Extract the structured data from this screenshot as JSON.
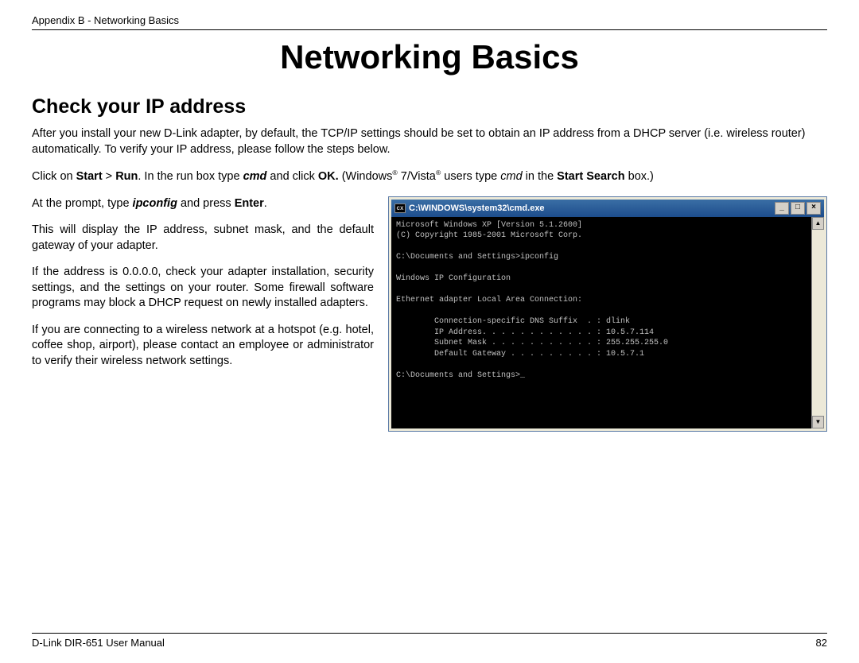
{
  "header": {
    "appendix": "Appendix B - Networking Basics"
  },
  "title": "Networking Basics",
  "section": "Check your IP address",
  "intro": "After you install your new D-Link adapter, by default, the TCP/IP settings should be set to obtain an IP address from a DHCP server (i.e. wireless router) automatically. To verify your IP address, please follow the steps below.",
  "run": {
    "t1": "Click on ",
    "b1": "Start",
    "t2": " > ",
    "b2": "Run",
    "t3": ". In the run box type ",
    "bi1": "cmd",
    "t4": " and click ",
    "b3": "OK.",
    "t5": " (Windows",
    "sup1": "®",
    "t6": " 7/Vista",
    "sup2": "®",
    "t7": " users type ",
    "i1": "cmd",
    "t8": " in the ",
    "b4": "Start Search",
    "t9": " box.)"
  },
  "left": {
    "p1a": "At the prompt, type ",
    "p1b": "ipconfig",
    "p1c": " and press ",
    "p1d": "Enter",
    "p1e": ".",
    "p2": "This will display the IP address, subnet mask, and the default gateway of your adapter.",
    "p3": "If the address is 0.0.0.0, check your adapter installation, security settings, and the settings on your router. Some firewall software programs may block a DHCP request on newly installed adapters.",
    "p4": "If you are connecting to a wireless network at a hotspot (e.g. hotel, coffee shop, airport), please contact an employee or administrator to verify their wireless network settings."
  },
  "cmd": {
    "title": "C:\\WINDOWS\\system32\\cmd.exe",
    "icon_label": "cx",
    "min": "_",
    "max": "□",
    "close": "×",
    "up": "▲",
    "down": "▼",
    "lines": "Microsoft Windows XP [Version 5.1.2600]\n(C) Copyright 1985-2001 Microsoft Corp.\n\nC:\\Documents and Settings>ipconfig\n\nWindows IP Configuration\n\nEthernet adapter Local Area Connection:\n\n        Connection-specific DNS Suffix  . : dlink\n        IP Address. . . . . . . . . . . . : 10.5.7.114\n        Subnet Mask . . . . . . . . . . . : 255.255.255.0\n        Default Gateway . . . . . . . . . : 10.5.7.1\n\nC:\\Documents and Settings>_"
  },
  "footer": {
    "left": "D-Link DIR-651 User Manual",
    "right": "82"
  }
}
